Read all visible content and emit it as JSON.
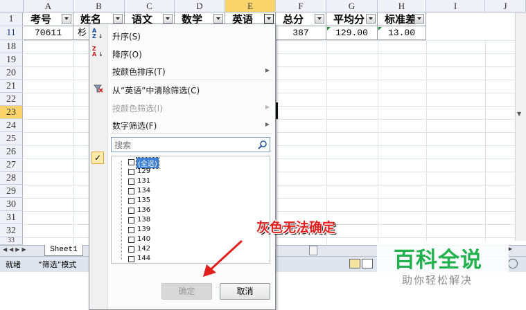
{
  "columns": [
    "A",
    "B",
    "C",
    "D",
    "E",
    "F",
    "G",
    "H",
    "I",
    "J"
  ],
  "rows": [
    "1",
    "11",
    "18",
    "19",
    "20",
    "21",
    "22",
    "23",
    "24",
    "25",
    "26",
    "27",
    "28",
    "29",
    "30",
    "31",
    "32",
    "33"
  ],
  "header_cells": [
    "考号",
    "姓名",
    "语文",
    "数学",
    "英语",
    "总分",
    "平均分",
    "标准差"
  ],
  "data_row": [
    "70611",
    "杉",
    "",
    "",
    "",
    "387",
    "129.00",
    "13.00"
  ],
  "sheet_tab": "Sheet1",
  "status": {
    "ready": "就绪",
    "filter_mode": "“筛选”模式"
  },
  "menu": {
    "sort_asc": "升序(S)",
    "sort_desc": "降序(O)",
    "sort_by_color": "按颜色排序(T)",
    "clear_filter": "从“英语”中清除筛选(C)",
    "filter_by_color": "按颜色筛选(I)",
    "number_filter": "数字筛选(F)",
    "search_placeholder": "搜索",
    "select_all": "(全选)",
    "values": [
      "129",
      "131",
      "134",
      "135",
      "136",
      "138",
      "139",
      "140",
      "142",
      "144"
    ],
    "ok": "确定",
    "cancel": "取消"
  },
  "annotation": "灰色无法确定",
  "watermark": {
    "title": "百科全说",
    "subtitle": "助你轻松解决"
  },
  "colors": {
    "annotation": "#e0201e",
    "watermark_green": "#22b14c",
    "selected_header": "#f8d46a"
  }
}
